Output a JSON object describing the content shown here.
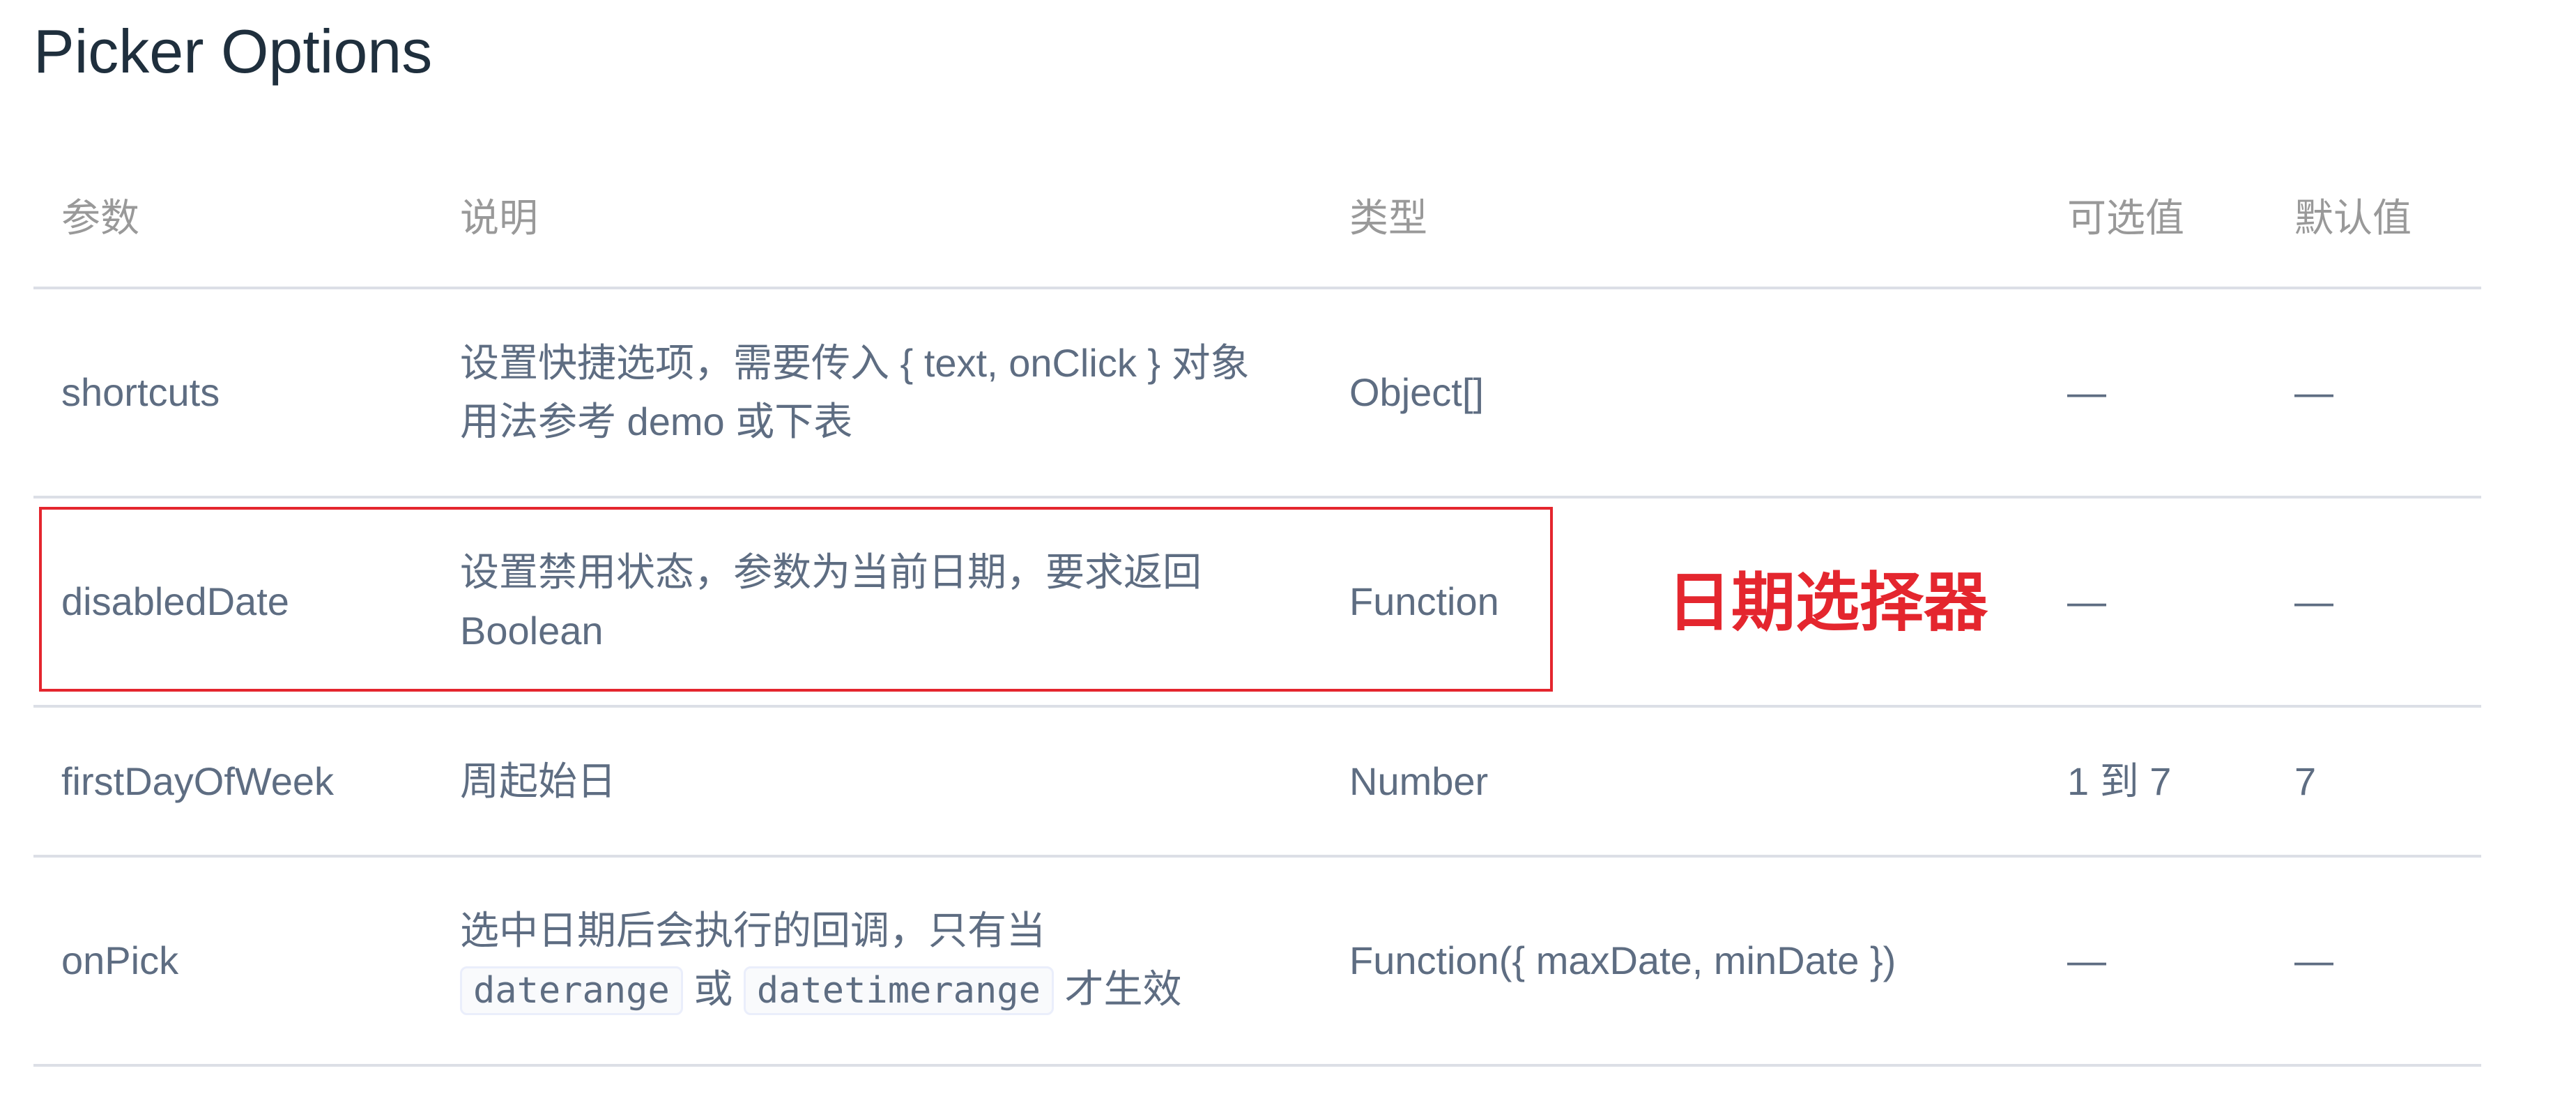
{
  "title": "Picker Options",
  "table": {
    "headers": {
      "param": "参数",
      "desc": "说明",
      "type": "类型",
      "options": "可选值",
      "default": "默认值"
    },
    "rows": [
      {
        "param": "shortcuts",
        "desc_line1": "设置快捷选项，需要传入 { text, onClick } 对象",
        "desc_line2": "用法参考 demo 或下表",
        "type": "Object[]",
        "options": "—",
        "default": "—"
      },
      {
        "param": "disabledDate",
        "desc_line1": "设置禁用状态，参数为当前日期，要求返回",
        "desc_line2": "Boolean",
        "type": "Function",
        "options": "—",
        "default": "—"
      },
      {
        "param": "firstDayOfWeek",
        "desc_line1": "周起始日",
        "type": "Number",
        "options": "1 到 7",
        "default": "7"
      },
      {
        "param": "onPick",
        "desc_line1": "选中日期后会执行的回调，只有当",
        "desc_code1": "daterange",
        "desc_or": "或",
        "desc_code2": "datetimerange",
        "desc_tail": "才生效",
        "type": "Function({ maxDate, minDate })",
        "options": "—",
        "default": "—"
      }
    ]
  },
  "annotation": {
    "label": "日期选择器",
    "color": "#e4262e"
  }
}
